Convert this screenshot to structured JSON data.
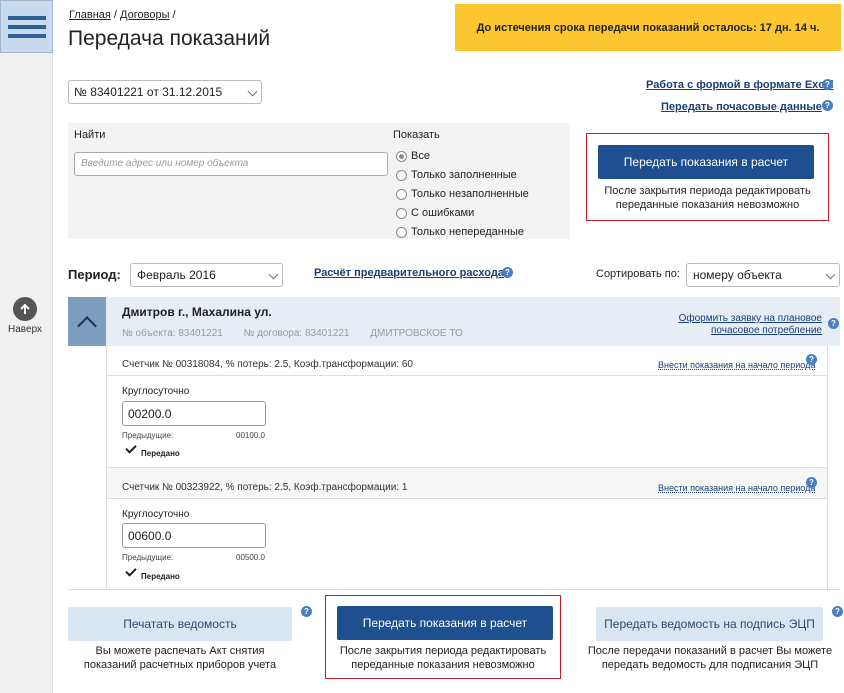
{
  "rail": {
    "up_label": "Наверх"
  },
  "breadcrumb": {
    "home": "Главная",
    "sep1": " / ",
    "contracts": "Договоры",
    "sep2": " /"
  },
  "page_title": "Передача показаний",
  "deadline_banner": "До истечения срока передачи показаний осталось: 17 дн. 14 ч.",
  "contract_select": {
    "value": "№ 83401221 от 31.12.2015"
  },
  "top_links": {
    "excel": "Работа с формой в формате Excel",
    "hourly": "Передать почасовые данные"
  },
  "filter": {
    "find_label": "Найти",
    "search_placeholder": "Введите адрес или номер объекта",
    "show_label": "Показать",
    "options": [
      "Все",
      "Только заполненные",
      "Только незаполненные",
      "С ошибками",
      "Только непереданные"
    ],
    "selected": "Все"
  },
  "submit_top": {
    "button": "Передать показания в расчет",
    "note_line1": "После закрытия периода редактировать",
    "note_line2": "переданные показания невозможно"
  },
  "period": {
    "label": "Период:",
    "value": "Февраль 2016",
    "link": "Расчёт предварительного расхода"
  },
  "sort": {
    "label": "Сортировать по:",
    "value": "номеру объекта"
  },
  "object": {
    "name": "Дмитров г., Махалина ул.",
    "object_no": "№ объекта: 83401221",
    "contract_no": "№ договора: 83401221",
    "region": "ДМИТРОВСКОЕ ТО",
    "link_line1": "Оформить заявку на плановое",
    "link_line2": "почасовое потребление"
  },
  "meters": [
    {
      "title": "Счетчик № 00318084, % потерь: 2.5, Коэф.трансформации: 60",
      "link": "Внести показания на начало периода",
      "zone": "Круглосуточно",
      "value": "00200.0",
      "prev_label": "Предыдущие:",
      "prev_value": "00100.0",
      "status": "Передано"
    },
    {
      "title": "Счетчик № 00323922, % потерь: 2.5, Коэф.трансформации: 1",
      "link": "Внести показания на начало периода",
      "zone": "Круглосуточно",
      "value": "00600.0",
      "prev_label": "Предыдущие:",
      "prev_value": "00500.0",
      "status": "Передано"
    }
  ],
  "bottom": {
    "print_button": "Печатать ведомость",
    "print_note_line1": "Вы можете распечать Акт снятия",
    "print_note_line2": "показаний расчетных приборов учета",
    "submit_button": "Передать показания в расчет",
    "submit_note_line1": "После закрытия периода редактировать",
    "submit_note_line2": "переданные показания невозможно",
    "sign_button": "Передать ведомость на подпись ЭЦП",
    "sign_note_line1": "После передачи показаний в расчет Вы можете",
    "sign_note_line2": "передать ведомость для подписания ЭЦП"
  },
  "colors": {
    "accent_blue": "#1e4f8e",
    "banner_yellow": "#fcc631",
    "highlight_red": "#c4202a",
    "light_button": "#d9e5f1"
  },
  "icons": [
    "menu-icon",
    "arrow-up-icon",
    "help-icon",
    "chevron-down-icon",
    "chevron-up-icon",
    "checkmark-icon"
  ]
}
